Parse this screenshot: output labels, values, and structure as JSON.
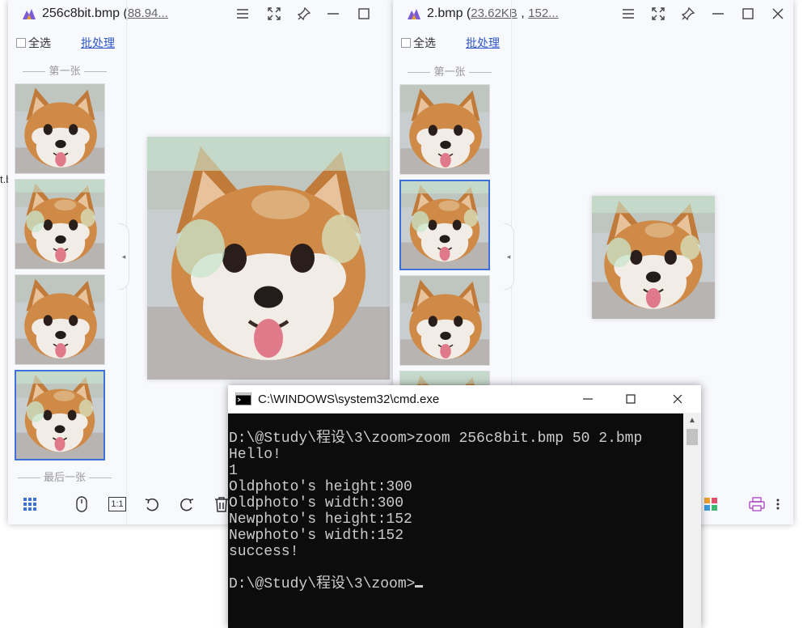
{
  "viewer1": {
    "filename": "256c8bit.bmp",
    "title_prefix": " (",
    "title_detail": "88.94...",
    "select_all": "全选",
    "batch": "批处理",
    "first_label": "第一张",
    "last_label": "最后一张"
  },
  "viewer2": {
    "filename": "2.bmp",
    "title_prefix": " (",
    "title_size": "23.62KB",
    "title_sep": " , ",
    "title_detail": "152...",
    "select_all": "全选",
    "batch": "批处理",
    "first_label": "第一张"
  },
  "stray_text": "t.b",
  "toolbar": {
    "actual_size": "1:1"
  },
  "cmd": {
    "title": "C:\\WINDOWS\\system32\\cmd.exe",
    "lines": [
      "D:\\@Study\\程设\\3\\zoom>zoom 256c8bit.bmp 50 2.bmp",
      "Hello!",
      "1",
      "Oldphoto's height:300",
      "Oldphoto's width:300",
      "Newphoto's height:152",
      "Newphoto's width:152",
      "success!",
      "",
      "D:\\@Study\\程设\\3\\zoom>"
    ]
  },
  "colors": {
    "accent": "#3c72d8",
    "link": "#3057c9",
    "cmd_bg": "#0c0c0c",
    "cmd_fg": "#cccccc"
  },
  "icons": [
    "app-logo-icon",
    "menu-icon",
    "fullscreen-icon",
    "pin-icon",
    "minimize-icon",
    "maximize-icon",
    "close-icon",
    "grid-icon",
    "mouse-icon",
    "rotate-left-icon",
    "rotate-right-icon",
    "delete-icon",
    "apps-icon",
    "print-icon",
    "more-icon",
    "cmd-icon"
  ]
}
